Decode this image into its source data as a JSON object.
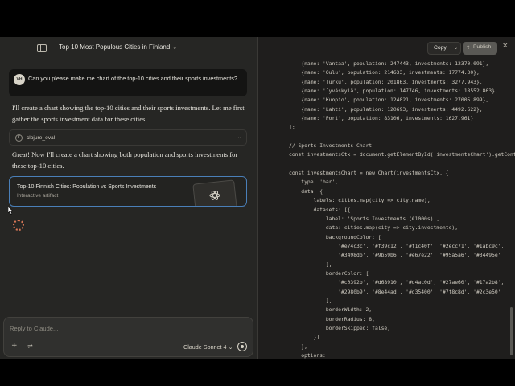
{
  "header": {
    "title": "Top 10 Most Populous Cities in Finland",
    "sidebar_toggle_icon": "sidebar-icon",
    "title_chevron_icon": "chevron-down-icon"
  },
  "conversation": {
    "user": {
      "initials": "VH",
      "message": "Can you please make me chart of the top-10 cities and their sports investments?"
    },
    "assistant_text_1": "I'll create a chart showing the top-10 cities and their sports investments. Let me first gather the sports investment data for these cities.",
    "tool": {
      "icon_glyph": "C",
      "label": "clojure_eval"
    },
    "assistant_text_2": "Great! Now I'll create a chart showing both population and sports investments for these top-10 cities.",
    "artifact": {
      "title": "Top-10 Finnish Cities: Population vs Sports Investments",
      "subtitle": "Interactive artifact"
    }
  },
  "composer": {
    "placeholder": "Reply to Claude...",
    "plus_glyph": "+",
    "tools_glyph": "⇌",
    "model": "Claude Sonnet 4",
    "model_chevron": "⌄"
  },
  "artifact_panel": {
    "copy_label": "Copy",
    "copy_chevron": "⌄",
    "publish_label": "Publish",
    "publish_glyph": "⇪",
    "close_glyph": "×",
    "code_lines": [
      "    {name: 'Vantaa', population: 247443, investments: 12370.091},",
      "    {name: 'Oulu', population: 214633, investments: 17774.30},",
      "    {name: 'Turku', population: 201863, investments: 3277.943},",
      "    {name: 'Jyväskylä', population: 147746, investments: 18552.863},",
      "    {name: 'Kuopio', population: 124021, investments: 27005.899},",
      "    {name: 'Lahti', population: 120693, investments: 4492.622},",
      "    {name: 'Pori', population: 83106, investments: 1627.961}",
      "];",
      "",
      "// Sports Investments Chart",
      "const investmentsCtx = document.getElementById('investmentsChart').getContext",
      "",
      "const investmentsChart = new Chart(investmentsCtx, {",
      "    type: 'bar',",
      "    data: {",
      "        labels: cities.map(city => city.name),",
      "        datasets: [{",
      "            label: 'Sports Investments (€1000s)',",
      "            data: cities.map(city => city.investments),",
      "            backgroundColor: [",
      "                '#e74c3c', '#f39c12', '#f1c40f', '#2ecc71', '#1abc9c',",
      "                '#3498db', '#9b59b6', '#e67e22', '#95a5a6', '#34495e'",
      "            ],",
      "            borderColor: [",
      "                '#c0392b', '#d68910', '#d4ac0d', '#27ae60', '#17a2b8',",
      "                '#2980b9', '#8e44ad', '#d35400', '#7f8c8d', '#2c3e50'",
      "            ],",
      "            borderWidth: 2,",
      "            borderRadius: 8,",
      "            borderSkipped: false,",
      "        }]",
      "    },",
      "    options:"
    ]
  },
  "colors": {
    "background": "#262624",
    "code_panel": "#1f1e1d",
    "artifact_border": "#4a7fb8",
    "spinner": "#d97757"
  }
}
